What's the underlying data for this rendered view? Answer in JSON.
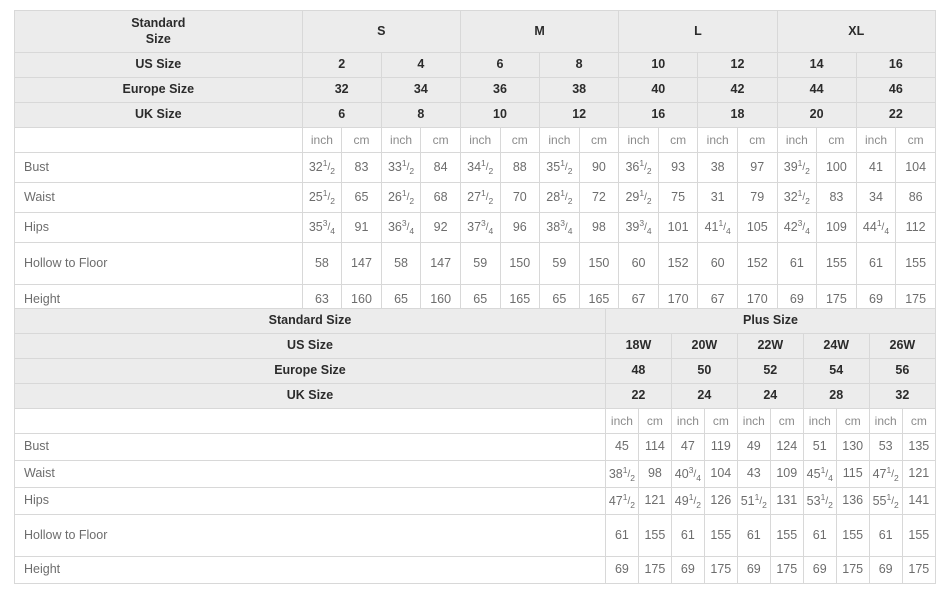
{
  "meta": {
    "colors": {
      "header_bg": "#ececec",
      "border": "#d8d8d8",
      "header_text": "#2b2b2b",
      "body_text": "#6d6d6d",
      "unit_text": "#8b8b8b",
      "page_bg": "#ffffff"
    }
  },
  "labels": {
    "standard_size": "Standard Size",
    "standard_size_wrapped_line1": "Standard",
    "standard_size_wrapped_line2": "Size",
    "us_size": "US Size",
    "europe_size": "Europe Size",
    "uk_size": "UK Size",
    "inch": "inch",
    "cm": "cm",
    "blank": "",
    "plus_size": "Plus Size"
  },
  "table1": {
    "size_groups": [
      {
        "label": "S",
        "span": 4
      },
      {
        "label": "M",
        "span": 4
      },
      {
        "label": "L",
        "span": 4
      },
      {
        "label": "XL",
        "span": 4
      }
    ],
    "us_sizes": [
      "2",
      "4",
      "6",
      "8",
      "10",
      "12",
      "14",
      "16"
    ],
    "europe_sizes": [
      "32",
      "34",
      "36",
      "38",
      "40",
      "42",
      "44",
      "46"
    ],
    "uk_sizes": [
      "6",
      "8",
      "10",
      "12",
      "16",
      "18",
      "20",
      "22"
    ],
    "units": [
      "inch",
      "cm",
      "inch",
      "cm",
      "inch",
      "cm",
      "inch",
      "cm",
      "inch",
      "cm",
      "inch",
      "cm",
      "inch",
      "cm",
      "inch",
      "cm"
    ],
    "rows": [
      {
        "label": "Bust",
        "tall": false,
        "values": [
          {
            "whole": "32",
            "num": "1",
            "den": "2"
          },
          {
            "whole": "83"
          },
          {
            "whole": "33",
            "num": "1",
            "den": "2"
          },
          {
            "whole": "84"
          },
          {
            "whole": "34",
            "num": "1",
            "den": "2"
          },
          {
            "whole": "88"
          },
          {
            "whole": "35",
            "num": "1",
            "den": "2"
          },
          {
            "whole": "90"
          },
          {
            "whole": "36",
            "num": "1",
            "den": "2"
          },
          {
            "whole": "93"
          },
          {
            "whole": "38"
          },
          {
            "whole": "97"
          },
          {
            "whole": "39",
            "num": "1",
            "den": "2"
          },
          {
            "whole": "100"
          },
          {
            "whole": "41"
          },
          {
            "whole": "104"
          }
        ]
      },
      {
        "label": "Waist",
        "tall": false,
        "values": [
          {
            "whole": "25",
            "num": "1",
            "den": "2"
          },
          {
            "whole": "65"
          },
          {
            "whole": "26",
            "num": "1",
            "den": "2"
          },
          {
            "whole": "68"
          },
          {
            "whole": "27",
            "num": "1",
            "den": "2"
          },
          {
            "whole": "70"
          },
          {
            "whole": "28",
            "num": "1",
            "den": "2"
          },
          {
            "whole": "72"
          },
          {
            "whole": "29",
            "num": "1",
            "den": "2"
          },
          {
            "whole": "75"
          },
          {
            "whole": "31"
          },
          {
            "whole": "79"
          },
          {
            "whole": "32",
            "num": "1",
            "den": "2"
          },
          {
            "whole": "83"
          },
          {
            "whole": "34"
          },
          {
            "whole": "86"
          }
        ]
      },
      {
        "label": "Hips",
        "tall": false,
        "values": [
          {
            "whole": "35",
            "num": "3",
            "den": "4"
          },
          {
            "whole": "91"
          },
          {
            "whole": "36",
            "num": "3",
            "den": "4"
          },
          {
            "whole": "92"
          },
          {
            "whole": "37",
            "num": "3",
            "den": "4"
          },
          {
            "whole": "96"
          },
          {
            "whole": "38",
            "num": "3",
            "den": "4"
          },
          {
            "whole": "98"
          },
          {
            "whole": "39",
            "num": "3",
            "den": "4"
          },
          {
            "whole": "101"
          },
          {
            "whole": "41",
            "num": "1",
            "den": "4"
          },
          {
            "whole": "105"
          },
          {
            "whole": "42",
            "num": "3",
            "den": "4"
          },
          {
            "whole": "109"
          },
          {
            "whole": "44",
            "num": "1",
            "den": "4"
          },
          {
            "whole": "112"
          }
        ]
      },
      {
        "label": "Hollow to Floor",
        "tall": true,
        "values": [
          {
            "whole": "58"
          },
          {
            "whole": "147"
          },
          {
            "whole": "58"
          },
          {
            "whole": "147"
          },
          {
            "whole": "59"
          },
          {
            "whole": "150"
          },
          {
            "whole": "59"
          },
          {
            "whole": "150"
          },
          {
            "whole": "60"
          },
          {
            "whole": "152"
          },
          {
            "whole": "60"
          },
          {
            "whole": "152"
          },
          {
            "whole": "61"
          },
          {
            "whole": "155"
          },
          {
            "whole": "61"
          },
          {
            "whole": "155"
          }
        ]
      },
      {
        "label": "Height",
        "tall": false,
        "values": [
          {
            "whole": "63"
          },
          {
            "whole": "160"
          },
          {
            "whole": "65"
          },
          {
            "whole": "160"
          },
          {
            "whole": "65"
          },
          {
            "whole": "165"
          },
          {
            "whole": "65"
          },
          {
            "whole": "165"
          },
          {
            "whole": "67"
          },
          {
            "whole": "170"
          },
          {
            "whole": "67"
          },
          {
            "whole": "170"
          },
          {
            "whole": "69"
          },
          {
            "whole": "175"
          },
          {
            "whole": "69"
          },
          {
            "whole": "175"
          }
        ]
      }
    ]
  },
  "table2": {
    "group_label": "Plus Size",
    "group_span": 10,
    "us_sizes": [
      "18W",
      "20W",
      "22W",
      "24W",
      "26W"
    ],
    "europe_sizes": [
      "48",
      "50",
      "52",
      "54",
      "56"
    ],
    "uk_sizes": [
      "22",
      "24",
      "24",
      "28",
      "32"
    ],
    "units": [
      "inch",
      "cm",
      "inch",
      "cm",
      "inch",
      "cm",
      "inch",
      "cm",
      "inch",
      "cm"
    ],
    "rows": [
      {
        "label": "Bust",
        "tall": false,
        "values": [
          {
            "whole": "45"
          },
          {
            "whole": "114"
          },
          {
            "whole": "47"
          },
          {
            "whole": "119"
          },
          {
            "whole": "49"
          },
          {
            "whole": "124"
          },
          {
            "whole": "51"
          },
          {
            "whole": "130"
          },
          {
            "whole": "53"
          },
          {
            "whole": "135"
          }
        ]
      },
      {
        "label": "Waist",
        "tall": false,
        "values": [
          {
            "whole": "38",
            "num": "1",
            "den": "2"
          },
          {
            "whole": "98"
          },
          {
            "whole": "40",
            "num": "3",
            "den": "4"
          },
          {
            "whole": "104"
          },
          {
            "whole": "43"
          },
          {
            "whole": "109"
          },
          {
            "whole": "45",
            "num": "1",
            "den": "4"
          },
          {
            "whole": "115"
          },
          {
            "whole": "47",
            "num": "1",
            "den": "2"
          },
          {
            "whole": "121"
          }
        ]
      },
      {
        "label": "Hips",
        "tall": false,
        "values": [
          {
            "whole": "47",
            "num": "1",
            "den": "2"
          },
          {
            "whole": "121"
          },
          {
            "whole": "49",
            "num": "1",
            "den": "2"
          },
          {
            "whole": "126"
          },
          {
            "whole": "51",
            "num": "1",
            "den": "2"
          },
          {
            "whole": "131"
          },
          {
            "whole": "53",
            "num": "1",
            "den": "2"
          },
          {
            "whole": "136"
          },
          {
            "whole": "55",
            "num": "1",
            "den": "2"
          },
          {
            "whole": "141"
          }
        ]
      },
      {
        "label": "Hollow to Floor",
        "tall": true,
        "values": [
          {
            "whole": "61"
          },
          {
            "whole": "155"
          },
          {
            "whole": "61"
          },
          {
            "whole": "155"
          },
          {
            "whole": "61"
          },
          {
            "whole": "155"
          },
          {
            "whole": "61"
          },
          {
            "whole": "155"
          },
          {
            "whole": "61"
          },
          {
            "whole": "155"
          }
        ]
      },
      {
        "label": "Height",
        "tall": false,
        "values": [
          {
            "whole": "69"
          },
          {
            "whole": "175"
          },
          {
            "whole": "69"
          },
          {
            "whole": "175"
          },
          {
            "whole": "69"
          },
          {
            "whole": "175"
          },
          {
            "whole": "69"
          },
          {
            "whole": "175"
          },
          {
            "whole": "69"
          },
          {
            "whole": "175"
          }
        ]
      }
    ]
  }
}
